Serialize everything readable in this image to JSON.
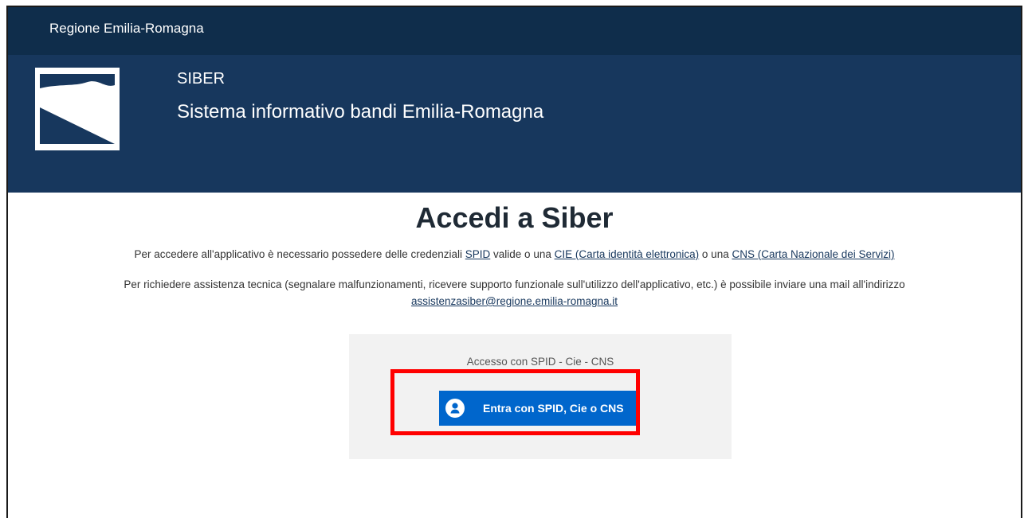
{
  "header": {
    "region": "Regione Emilia-Romagna",
    "app_title": "SIBER",
    "app_subtitle": "Sistema informativo bandi Emilia-Romagna"
  },
  "main": {
    "title": "Accedi a Siber",
    "info1": {
      "prefix": "Per accedere all'applicativo è necessario possedere delle credenziali ",
      "link_spid": "SPID",
      "mid1": " valide o una ",
      "link_cie": "CIE (Carta identità elettronica)",
      "mid2": " o una ",
      "link_cns": "CNS (Carta Nazionale dei Servizi)"
    },
    "info2": {
      "text": "Per richiedere assistenza tecnica (segnalare malfunzionamenti, ricevere supporto funzionale sull'utilizzo dell'applicativo, etc.) è possibile inviare una mail all'indirizzo",
      "email": "assistenzasiber@regione.emilia-romagna.it"
    },
    "login": {
      "caption": "Accesso con SPID - Cie - CNS",
      "button_label": "Entra con SPID, Cie o CNS",
      "button_icon": "user-icon"
    }
  },
  "colors": {
    "header_dark": "#0f2d4b",
    "header": "#17375d",
    "button": "#0066cc",
    "highlight": "#ff0000"
  }
}
